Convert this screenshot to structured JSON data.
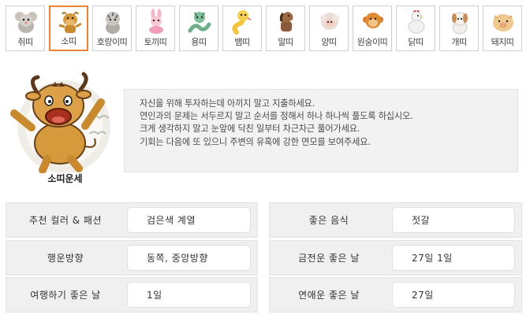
{
  "zodiac_tabs": [
    {
      "label": "쥐띠",
      "icon": "rat-icon",
      "active": false
    },
    {
      "label": "소띠",
      "icon": "ox-icon",
      "active": true
    },
    {
      "label": "호랑이띠",
      "icon": "tiger-icon",
      "active": false
    },
    {
      "label": "토끼띠",
      "icon": "rabbit-icon",
      "active": false
    },
    {
      "label": "용띠",
      "icon": "dragon-icon",
      "active": false
    },
    {
      "label": "뱀띠",
      "icon": "snake-icon",
      "active": false
    },
    {
      "label": "말띠",
      "icon": "horse-icon",
      "active": false
    },
    {
      "label": "양띠",
      "icon": "sheep-icon",
      "active": false
    },
    {
      "label": "원숭이띠",
      "icon": "monkey-icon",
      "active": false
    },
    {
      "label": "닭띠",
      "icon": "rooster-icon",
      "active": false
    },
    {
      "label": "개띠",
      "icon": "dog-icon",
      "active": false
    },
    {
      "label": "돼지띠",
      "icon": "pig-icon",
      "active": false
    }
  ],
  "hero": {
    "caption": "소띠운세",
    "icon": "ox-icon"
  },
  "fortune": {
    "lines": [
      "자신을 위해 투자하는데 아끼지 말고 지출하세요.",
      "연인과의 문제는 서두르지 말고 순서를 정해서 하나 하나씩 풀도록 하십시오.",
      "크게 생각하지 말고 눈앞에 닥친 일부터 차근차근 풀어가세요.",
      "기회는 다음에 또 있으니 주변의 유혹에 강한 면모를 보여주세요."
    ]
  },
  "info": {
    "color_fashion": {
      "label": "추천 컬러 & 패션",
      "value": "검은색 계열"
    },
    "good_food": {
      "label": "좋은 음식",
      "value": "젓갈"
    },
    "lucky_direction": {
      "label": "행운방향",
      "value": "동쪽, 중앙방향"
    },
    "money_day": {
      "label": "금전운 좋은 날",
      "value": "27일 1일"
    },
    "travel_day": {
      "label": "여행하기 좋은 날",
      "value": "1일"
    },
    "love_day": {
      "label": "연애운 좋은 날",
      "value": "27일"
    }
  },
  "colors": {
    "active_tab_border": "#e8823a",
    "box_bg": "#f2f2f2",
    "ox_body": "#d69a3c"
  }
}
